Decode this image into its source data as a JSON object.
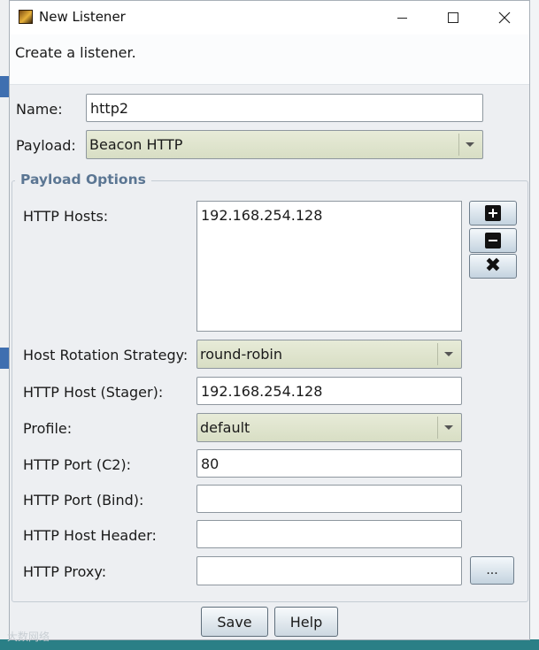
{
  "window": {
    "title": "New Listener",
    "description": "Create a listener."
  },
  "form": {
    "name_label": "Name:",
    "name_value": "http2",
    "payload_label": "Payload:",
    "payload_value": "Beacon HTTP"
  },
  "payload_options": {
    "title": "Payload Options",
    "http_hosts_label": "HTTP Hosts:",
    "http_hosts": [
      "192.168.254.128"
    ],
    "host_rotation_label": "Host Rotation Strategy:",
    "host_rotation_value": "round-robin",
    "stager_host_label": "HTTP Host (Stager):",
    "stager_host_value": "192.168.254.128",
    "profile_label": "Profile:",
    "profile_value": "default",
    "port_c2_label": "HTTP Port (C2):",
    "port_c2_value": "80",
    "port_bind_label": "HTTP Port (Bind):",
    "port_bind_value": "",
    "host_header_label": "HTTP Host Header:",
    "host_header_value": "",
    "proxy_label": "HTTP Proxy:",
    "proxy_value": "",
    "proxy_button_label": "..."
  },
  "buttons": {
    "save_label": "Save",
    "help_label": "Help"
  },
  "icons": {
    "add_host": "plus-square-icon",
    "remove_host": "minus-square-icon",
    "clear_hosts": "x-icon"
  },
  "watermark": "大数网络"
}
